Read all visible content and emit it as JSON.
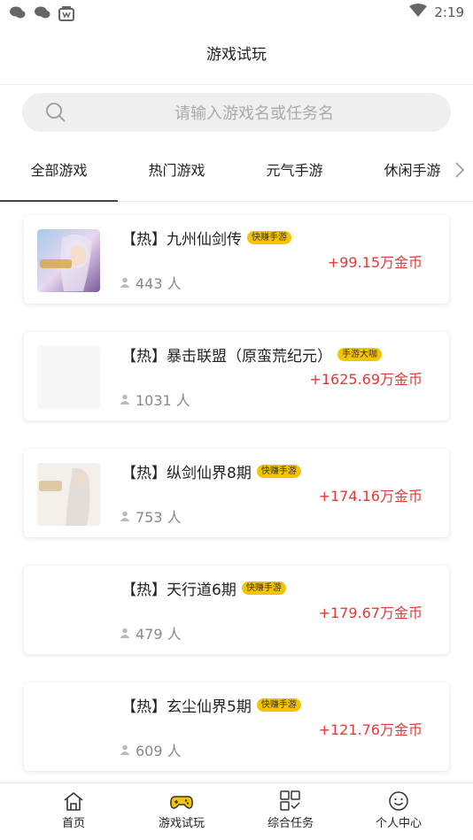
{
  "status": {
    "time": "2:19"
  },
  "header": {
    "title": "游戏试玩"
  },
  "search": {
    "placeholder": "请输入游戏名或任务名"
  },
  "tabs": [
    "全部游戏",
    "热门游戏",
    "元气手游",
    "休闲手游"
  ],
  "games": [
    {
      "title": "【热】九州仙剑传",
      "badge": "快赚手游",
      "reward": "+99.15万金币",
      "players": "443 人"
    },
    {
      "title": "【热】暴击联盟（原蛮荒纪元）",
      "badge": "手游大咖",
      "reward": "+1625.69万金币",
      "players": "1031 人"
    },
    {
      "title": "【热】纵剑仙界8期",
      "badge": "快赚手游",
      "reward": "+174.16万金币",
      "players": "753 人"
    },
    {
      "title": "【热】天行道6期",
      "badge": "快赚手游",
      "reward": "+179.67万金币",
      "players": "479 人"
    },
    {
      "title": "【热】玄尘仙界5期",
      "badge": "快赚手游",
      "reward": "+121.76万金币",
      "players": "609 人"
    }
  ],
  "nav": [
    "首页",
    "游戏试玩",
    "综合任务",
    "个人中心"
  ],
  "colors": {
    "accent": "#f5c400",
    "reward": "#e53935"
  }
}
